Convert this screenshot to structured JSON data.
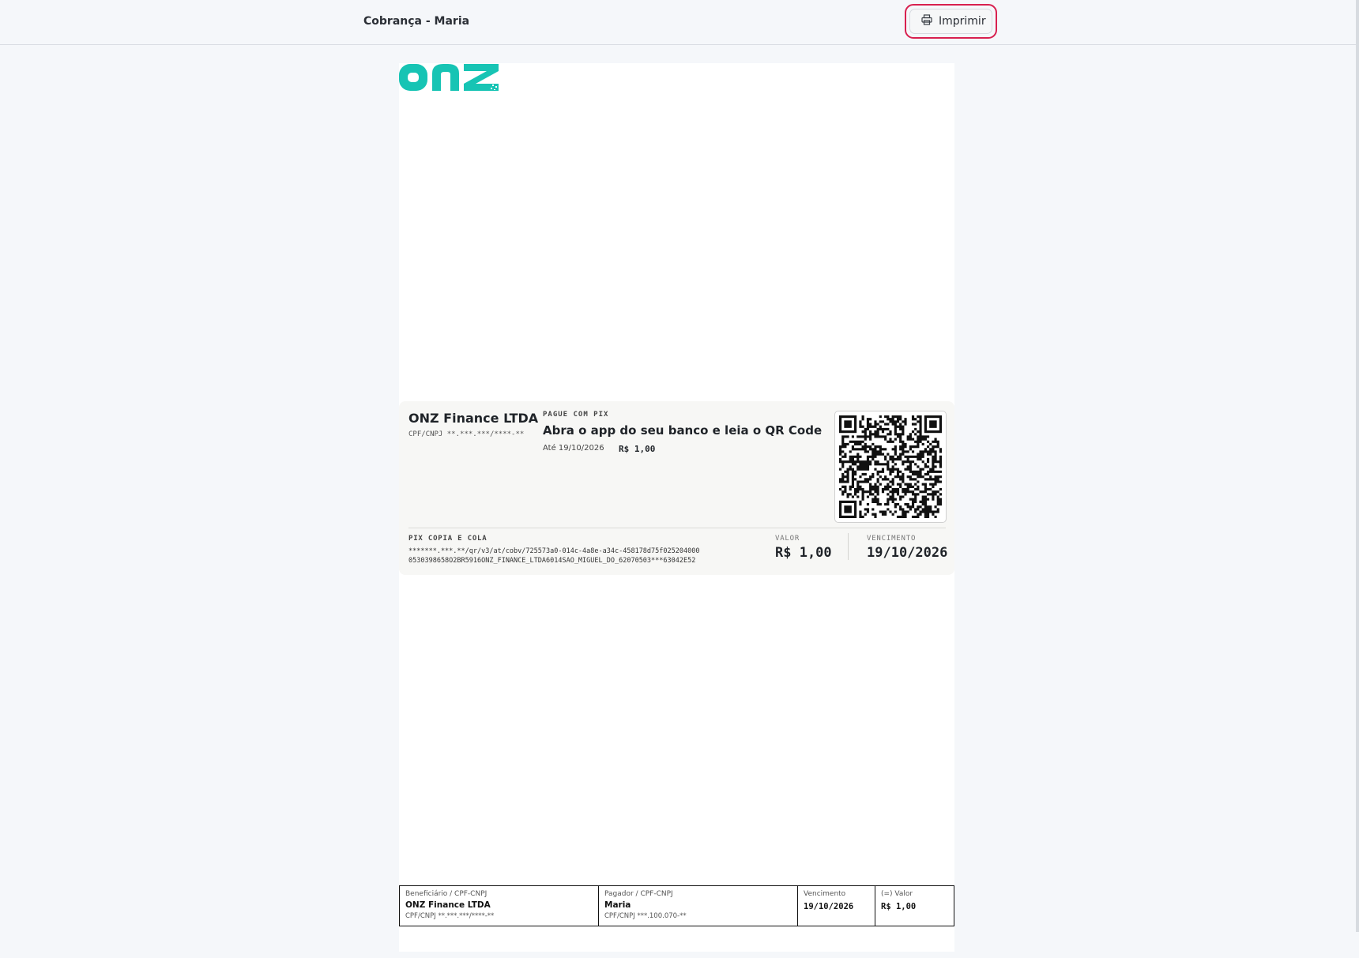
{
  "header": {
    "title": "Cobrança - Maria",
    "print_label": "Imprimir",
    "print_icon": "printer-icon"
  },
  "brand": {
    "logo_text": "onz",
    "logo_color": "#17c4b4"
  },
  "pix": {
    "beneficiary_name": "ONZ Finance LTDA",
    "beneficiary_doc": "CPF/CNPJ **.***.***/****-**",
    "tag": "PAGUE COM PIX",
    "headline": "Abra o app do seu banco e leia o QR Code",
    "until": "Até 19/10/2026",
    "amount": "R$ 1,00",
    "copy_label": "PIX COPIA E COLA",
    "copy_line1": "*******.***.**/qr/v3/at/cobv/725573a0-014c-4a8e-a34c-458178d75f025204000",
    "copy_line2": "0530398658O2BR5916ONZ_FINANCE_LTDA6014SAO_MIGUEL_DO_62070503***63042E52",
    "valor_label": "VALOR",
    "valor": "R$ 1,00",
    "vencimento_label": "VENCIMENTO",
    "vencimento": "19/10/2026"
  },
  "footer_table": {
    "beneficiario_label": "Beneficiário / CPF-CNPJ",
    "beneficiario_name": "ONZ Finance LTDA",
    "beneficiario_doc": "CPF/CNPJ **.***.***/****-**",
    "pagador_label": "Pagador / CPF-CNPJ",
    "pagador_name": "Maria",
    "pagador_doc": "CPF/CNPJ ***.100.070-**",
    "vencimento_label": "Vencimento",
    "vencimento": "19/10/2026",
    "valor_label": "(=) Valor",
    "valor": "R$ 1,00"
  },
  "colors": {
    "accent_ring": "#d8204f",
    "page_bg": "#f5f7fa",
    "pix_box_bg": "#f7f7f5"
  }
}
